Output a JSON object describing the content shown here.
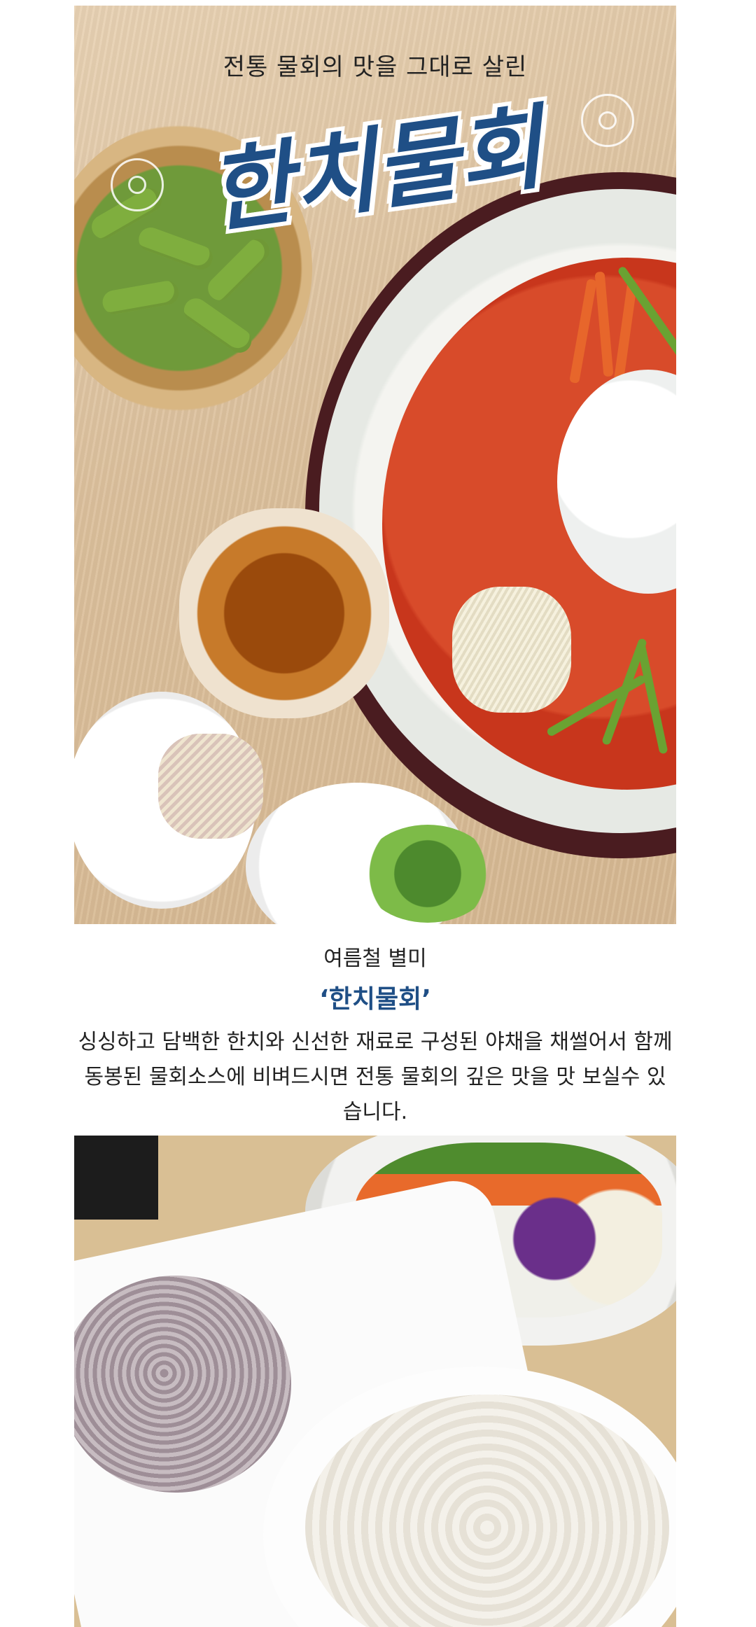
{
  "hero": {
    "subtitle": "전통 물회의 맛을 그대로 살린",
    "title": "한치물회"
  },
  "description": {
    "season": "여름철 별미",
    "dish_name": "‘한치물회’",
    "body": "싱싱하고 담백한 한치와 신선한 재료로 구성된 야채을 채썰어서 함께 동봉된 물회소스에 비벼드시면 전통 물회의 깊은 맛을 맛 보실수 있습니다."
  },
  "colors": {
    "accent": "#1f4f86",
    "text": "#222222"
  }
}
